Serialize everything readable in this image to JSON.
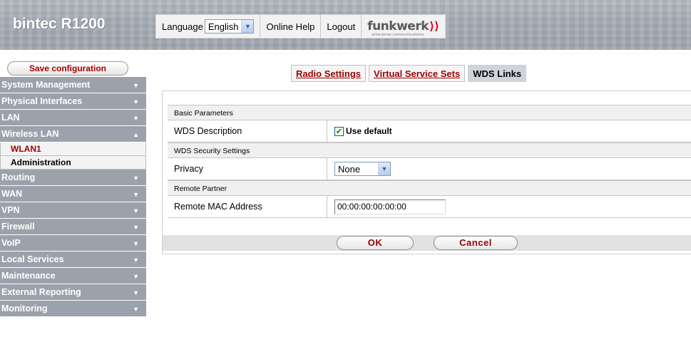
{
  "header": {
    "brand": "bintec R1200",
    "language_label": "Language",
    "language_value": "English",
    "online_help": "Online Help",
    "logout": "Logout",
    "logo_text": "funkwerk",
    "logo_subtext": "enterprise communications"
  },
  "sidebar": {
    "save_label": "Save configuration",
    "items": [
      {
        "label": "System Management"
      },
      {
        "label": "Physical Interfaces"
      },
      {
        "label": "LAN"
      },
      {
        "label": "Wireless LAN",
        "expanded": true
      },
      {
        "label": "Routing"
      },
      {
        "label": "WAN"
      },
      {
        "label": "VPN"
      },
      {
        "label": "Firewall"
      },
      {
        "label": "VoIP"
      },
      {
        "label": "Local Services"
      },
      {
        "label": "Maintenance"
      },
      {
        "label": "External Reporting"
      },
      {
        "label": "Monitoring"
      }
    ],
    "subitems": [
      {
        "label": "WLAN1",
        "active": true
      },
      {
        "label": "Administration",
        "active": false
      }
    ]
  },
  "tabs": [
    {
      "label": "Radio Settings"
    },
    {
      "label": "Virtual Service Sets"
    },
    {
      "label": "WDS Links",
      "current": true
    }
  ],
  "form": {
    "basic_parameters": "Basic Parameters",
    "wds_description_label": "WDS Description",
    "use_default_label": "Use default",
    "use_default_checked": true,
    "wds_security_settings": "WDS Security Settings",
    "privacy_label": "Privacy",
    "privacy_value": "None",
    "remote_partner": "Remote Partner",
    "remote_mac_label": "Remote MAC Address",
    "remote_mac_value": "00:00:00:00:00:00"
  },
  "actions": {
    "ok": "OK",
    "cancel": "Cancel"
  },
  "colors": {
    "accent_red": "#9a0000",
    "nav_bg": "#9ba2ab",
    "active_tab_bg": "#d0d4da"
  }
}
